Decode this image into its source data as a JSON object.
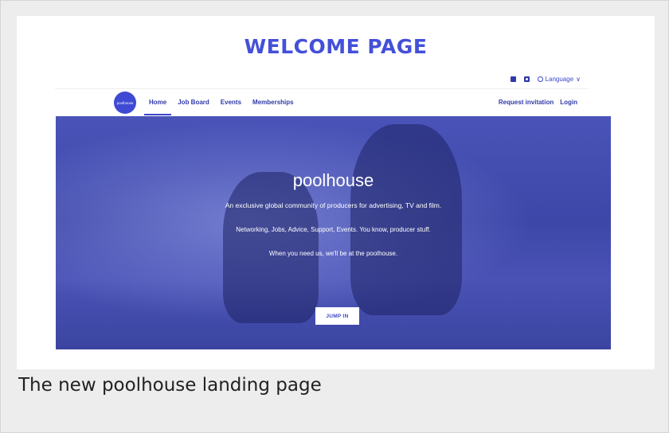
{
  "page": {
    "title": "WELCOME PAGE",
    "caption": "The new poolhouse landing page"
  },
  "topbar": {
    "icons": [
      "linkedin-icon",
      "instagram-icon",
      "globe-icon"
    ],
    "language_label": "Language",
    "chevron": "∨"
  },
  "nav": {
    "logo_text": "poolhouse",
    "links": [
      "Home",
      "Job Board",
      "Events",
      "Memberships"
    ],
    "active": "Home",
    "request_label": "Request invitation",
    "login_label": "Login"
  },
  "hero": {
    "title": "poolhouse",
    "tagline": "An exclusive global community of producers for advertising, TV and film.",
    "subline": "Networking, Jobs, Advice, Support, Events. You know, producer stuff.",
    "closing": "When you need us, we'll be at the poolhouse.",
    "cta_label": "JUMP IN"
  },
  "colors": {
    "accent": "#4450d8",
    "hero_overlay": "#3d47a8",
    "nav_text": "#2f3aa8",
    "background": "#ededed"
  }
}
